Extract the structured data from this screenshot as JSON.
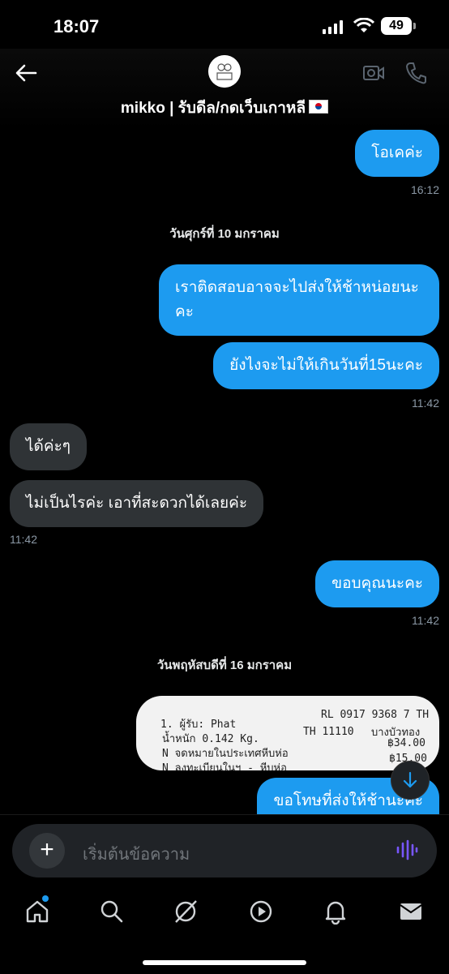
{
  "status_bar": {
    "time": "18:07",
    "battery": "49"
  },
  "header": {
    "name": "mikko | รับดีล/กดเว็บเกาหลี"
  },
  "messages": [
    {
      "text": "โอเคค่ะ",
      "time": "16:12"
    },
    {
      "date": "วันศุกร์ที่ 10 มกราคม"
    },
    {
      "text": "เราติดสอบอาจจะไปส่งให้ช้าหน่อยนะคะ"
    },
    {
      "text": "ยังไงจะไม่ให้เกินวันที่15นะคะ",
      "time": "11:42"
    },
    {
      "text": "ได้ค่ะๆ"
    },
    {
      "text": "ไม่เป็นไรค่ะ เอาที่สะดวกได้เลยค่ะ",
      "time": "11:42"
    },
    {
      "text": "ขอบคุณนะคะ",
      "time": "11:42"
    },
    {
      "date": "วันพฤหัสบดีที่ 16 มกราคม"
    },
    {
      "text": "ขอโทษที่ส่งให้ช้านะคะ"
    }
  ],
  "receipt": {
    "line1_left": "1. ผู้รับ: Phat",
    "line1_right": "RL 0917 9368 7 TH",
    "line2_left": "น้ำหนัก  0.142 Kg.",
    "line2_mid": "TH 11110",
    "line2_right": "บางบัวทอง",
    "line3_left": "N จดหมายในประเทศหีบห่อ",
    "line3_right": "฿34.00",
    "line4_left": "N ลงทะเบียนในฯ - หีบห่อ",
    "line4_right": "฿15.00"
  },
  "composer": {
    "placeholder": "เริ่มต้นข้อความ"
  },
  "colors": {
    "accent": "#1d9bf0",
    "incoming": "#2f3336",
    "background": "#000000"
  },
  "nav": [
    "home-icon",
    "search-icon",
    "grok-icon",
    "video-icon",
    "bell-icon",
    "mail-icon"
  ]
}
